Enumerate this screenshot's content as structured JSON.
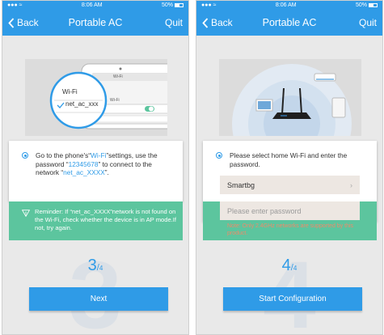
{
  "status": {
    "time": "8:06 AM",
    "battery": "50%"
  },
  "nav": {
    "back": "Back",
    "title": "Portable AC",
    "quit": "Quit"
  },
  "screen1": {
    "illustration": {
      "wifi_label": "Wi-Fi",
      "network": "net_ac_xxx",
      "phone_wifi_label": "Wi-Fi",
      "phone_row": "Wi-Fi"
    },
    "instruction": {
      "p1": "Go to the phone's“",
      "wifi": "Wi-Fi",
      "p2": "”settings, use the password “",
      "password": "12345678",
      "p3": "” to connect to the network “",
      "network": "net_ac_XXXX",
      "p4": "”."
    },
    "reminder": "Reminder: If “net_ac_XXXX”network is not found on the Wi-Fi, check whether the device is in AP mode.If not, try again.",
    "step": {
      "current": "3",
      "total": "4"
    },
    "watermark": "3",
    "button": "Next"
  },
  "screen2": {
    "instruction": "Please select home Wi-Fi and enter the password.",
    "ssid_value": "Smartbg",
    "password_placeholder": "Please enter password",
    "note": "Note: Only 2.4GHz networks are supported by this product.",
    "step": {
      "current": "4",
      "total": "4"
    },
    "watermark": "4",
    "button": "Start Configuration"
  },
  "colors": {
    "accent": "#2f9be7",
    "reminder_bg": "#5cc59e",
    "note_text": "#f08a6a",
    "field_bg": "#ede7e2"
  }
}
